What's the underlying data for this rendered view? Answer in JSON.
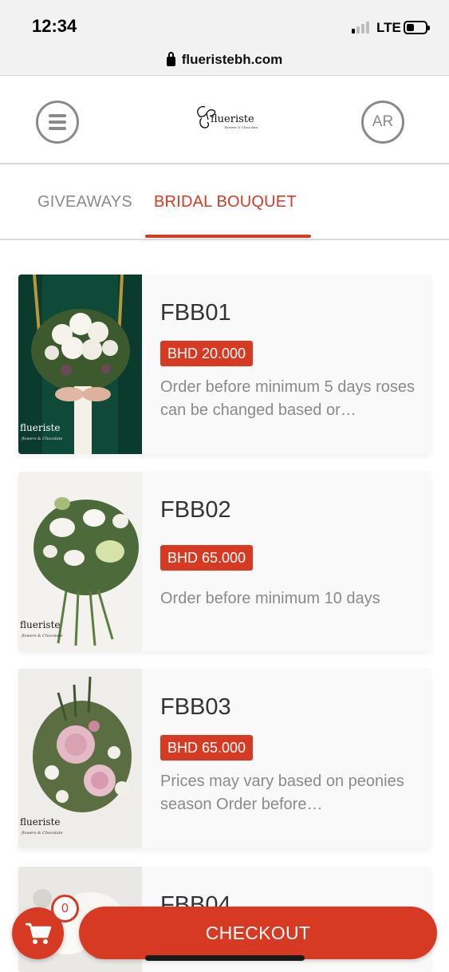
{
  "status_bar": {
    "time": "12:34",
    "network": "LTE"
  },
  "url_bar": {
    "url": "flueristebh.com"
  },
  "header": {
    "logo_text": "flueriste",
    "logo_subtext": "flowers & Chocolate",
    "lang_button": "AR"
  },
  "tabs": [
    {
      "label": "GIVEAWAYS",
      "active": false
    },
    {
      "label": "BRIDAL BOUQUET",
      "active": true
    }
  ],
  "products": [
    {
      "code": "FBB01",
      "price": "BHD 20.000",
      "description": "Order before minimum 5 days roses can be changed based or…",
      "image_brand": "flueriste",
      "image_brand_sub": "flowers & Chocolate"
    },
    {
      "code": "FBB02",
      "price": "BHD 65.000",
      "description": "Order before minimum 10 days",
      "image_brand": "flueriste",
      "image_brand_sub": "flowers & Chocolate"
    },
    {
      "code": "FBB03",
      "price": "BHD 65.000",
      "description": "Prices may vary based on peonies season Order before…",
      "image_brand": "flueriste",
      "image_brand_sub": "flowers & Chocolate"
    },
    {
      "code": "FBB04",
      "price": "",
      "description": ""
    }
  ],
  "cart": {
    "count": "0"
  },
  "checkout_label": "CHECKOUT",
  "colors": {
    "accent": "#d63a23",
    "muted_text": "#8a8a8a",
    "card_bg": "#f9f9f9"
  }
}
